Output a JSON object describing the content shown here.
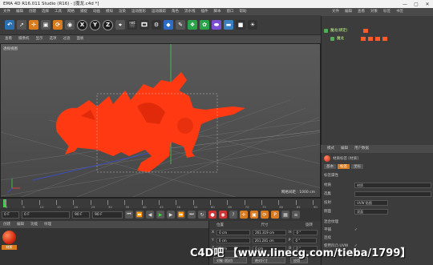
{
  "window": {
    "title": "EMA 4D R16.011 Studio (R16) - [魔龙.c4d *]",
    "controls": [
      "—",
      "▢",
      "✕"
    ]
  },
  "menu": [
    "文件",
    "编辑",
    "创建",
    "选择",
    "工具",
    "网格",
    "捕捉",
    "动画",
    "模拟",
    "渲染",
    "运动图形",
    "运动跟踪",
    "角色",
    "流水线",
    "插件",
    "脚本",
    "窗口",
    "帮助"
  ],
  "toolbar": {
    "axis_x": "X",
    "axis_y": "Y",
    "axis_z": "Z"
  },
  "viewport_menu": [
    "查看",
    "摄像机",
    "显示",
    "选项",
    "过滤",
    "面板"
  ],
  "viewport": {
    "label": "透视视图",
    "grid_spacing": "网格间距 : 1000 cm"
  },
  "object_manager": {
    "tabs": [
      "文件",
      "编辑",
      "查看",
      "对象",
      "标签",
      "书签"
    ],
    "objects": [
      {
        "name": "魔龙(绑定)"
      },
      {
        "name": "魔龙"
      }
    ]
  },
  "attribute_manager": {
    "menu": [
      "模式",
      "编辑",
      "用户数据"
    ],
    "tag_title": "材质标签 [材质]",
    "tabs": [
      "基本",
      "标签",
      "坐标"
    ],
    "section": "标签属性",
    "rows": [
      {
        "label": "材质",
        "value": "材质"
      },
      {
        "label": "选集",
        "value": ""
      },
      {
        "label": "投射",
        "value": "UVW 贴图"
      },
      {
        "label": "侧面",
        "value": "双面"
      },
      {
        "label": "混合纹理",
        "value": ""
      },
      {
        "label": "平铺",
        "value": "✓"
      },
      {
        "label": "连续",
        "value": ""
      },
      {
        "label": "使用凹凸 UVW",
        "value": "✓"
      }
    ]
  },
  "timeline": {
    "ticks": [
      "0",
      "5",
      "10",
      "15",
      "20",
      "25",
      "30",
      "35",
      "40",
      "45",
      "50",
      "55",
      "60",
      "65",
      "70",
      "75",
      "80",
      "85",
      "90"
    ],
    "current_frame_field": "0 F",
    "start_field": "0 F",
    "end_field": "90 F",
    "end_field2": "90 F"
  },
  "material_manager": {
    "menu": [
      "创建",
      "编辑",
      "功能",
      "纹理"
    ],
    "material_name": "材质"
  },
  "coordinates": {
    "headers": [
      "位置",
      "尺寸",
      "旋转"
    ],
    "rows": [
      {
        "axis": "X",
        "pos": "0 cm",
        "size": "261.319 cm",
        "rot_label": "H",
        "rot": "0 °"
      },
      {
        "axis": "Y",
        "pos": "0 cm",
        "size": "261.281 cm",
        "rot_label": "P",
        "rot": "0 °"
      },
      {
        "axis": "Z",
        "pos": "0 cm",
        "size": "0 cm",
        "rot_label": "B",
        "rot": "0 °"
      }
    ],
    "mode": "对象 (相对)",
    "size_mode": "绝对尺寸",
    "apply": "应用"
  },
  "watermark": "C4D吧 【www.linecg.com/tieba/1799】",
  "colors": {
    "dragon": "#ff3a12",
    "accent": "#d87a1e",
    "green_axis": "#3fd24a",
    "blue_axis": "#3a4fe0"
  }
}
